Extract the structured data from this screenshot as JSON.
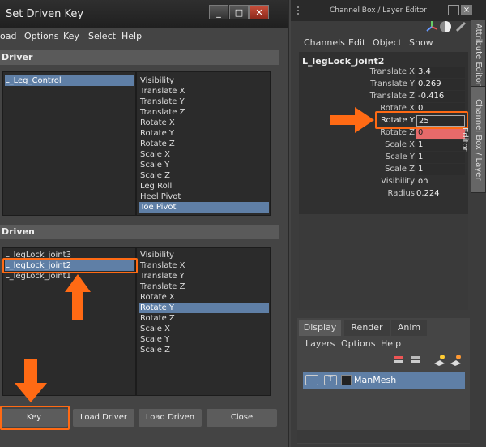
{
  "sdk": {
    "title": "Set Driven Key",
    "window_buttons": [
      "_",
      "□",
      "✕"
    ],
    "menu": [
      "oad",
      "Options",
      "Key",
      "Select",
      "Help"
    ],
    "driver_header": "Driver",
    "driver_objects": [
      "L_Leg_Control"
    ],
    "driver_attrs": [
      "Visibility",
      "Translate X",
      "Translate Y",
      "Translate Z",
      "Rotate X",
      "Rotate Y",
      "Rotate Z",
      "Scale X",
      "Scale Y",
      "Scale Z",
      "Leg Roll",
      "Heel Pivot",
      "Toe Pivot"
    ],
    "driven_header": "Driven",
    "driven_objects": [
      "L_legLock_joint3",
      "L_legLock_joint2",
      "L_legLock_joint1"
    ],
    "driven_attrs": [
      "Visibility",
      "Translate X",
      "Translate Y",
      "Translate Z",
      "Rotate X",
      "Rotate Y",
      "Rotate Z",
      "Scale X",
      "Scale Y",
      "Scale Z"
    ],
    "buttons": {
      "key": "Key",
      "load_driver": "Load Driver",
      "load_driven": "Load Driven",
      "close": "Close"
    }
  },
  "channel_box": {
    "title": "Channel Box / Layer Editor",
    "menu": [
      "Channels",
      "Edit",
      "Object",
      "Show"
    ],
    "object": "L_legLock_joint2",
    "channels": [
      {
        "label": "Translate X",
        "value": "3.4"
      },
      {
        "label": "Translate Y",
        "value": "0.269"
      },
      {
        "label": "Translate Z",
        "value": "-0.416"
      },
      {
        "label": "Rotate X",
        "value": "0"
      },
      {
        "label": "Rotate Y",
        "value": "25"
      },
      {
        "label": "Rotate Z",
        "value": "0"
      },
      {
        "label": "Scale X",
        "value": "1"
      },
      {
        "label": "Scale Y",
        "value": "1"
      },
      {
        "label": "Scale Z",
        "value": "1"
      },
      {
        "label": "Visibility",
        "value": "on"
      },
      {
        "label": "Radius",
        "value": "0.224"
      }
    ],
    "side_tabs": [
      "Attribute Editor",
      "Channel Box / Layer Editor"
    ],
    "layer_tabs": [
      "Display",
      "Render",
      "Anim"
    ],
    "layer_menu": [
      "Layers",
      "Options",
      "Help"
    ],
    "layer": {
      "v": "",
      "t": "T",
      "name": "ManMesh"
    }
  },
  "colors": {
    "highlight": "#ff6a14",
    "selection": "#5f7fa6",
    "keyed": "#e66a6a"
  }
}
